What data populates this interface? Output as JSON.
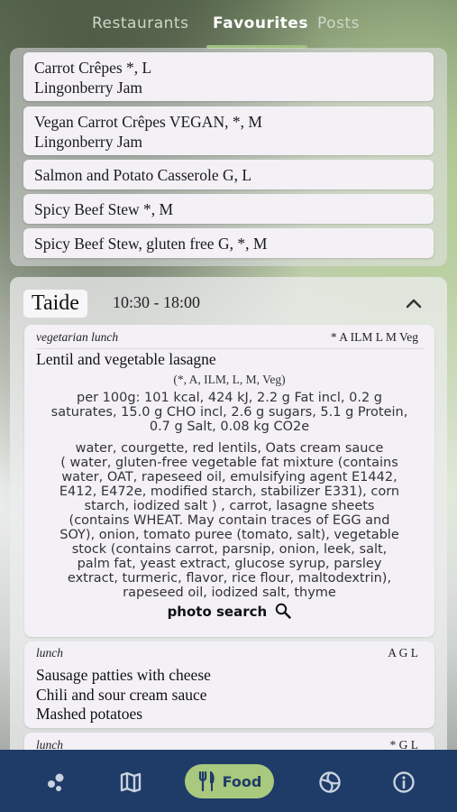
{
  "tabs": [
    {
      "label": "Restaurants",
      "active": false
    },
    {
      "label": "Favourites",
      "active": true
    },
    {
      "label": "Posts",
      "active": false
    }
  ],
  "favourites": [
    {
      "line1": "Carrot Crêpes *, L",
      "line2": "Lingonberry Jam"
    },
    {
      "line1": "Vegan Carrot Crêpes VEGAN, *, M",
      "line2": "Lingonberry Jam"
    },
    {
      "line1": "Salmon and Potato Casserole G, L"
    },
    {
      "line1": "Spicy Beef Stew *, M"
    },
    {
      "line1": "Spicy Beef Stew, gluten free G, *, M"
    }
  ],
  "restaurant": {
    "name": "Taide",
    "hours": "10:30 - 18:00",
    "menus": [
      {
        "category": "vegetarian lunch",
        "codes": "* A ILM L M Veg",
        "dish": "Lentil and vegetable lasagne",
        "dish_codes": "(*, A, ILM, L, M, Veg)",
        "nutrition_lines": [
          "per 100g: 101 kcal, 424 kJ, 2.2 g Fat incl, 0.2 g",
          "saturates, 15.0 g CHO incl, 2.6 g sugars, 5.1 g Protein,",
          "0.7 g Salt, 0.08 kg CO2e"
        ],
        "ingredient_lines": [
          "water, courgette, red lentils, Oats cream sauce",
          "( water, gluten-free vegetable fat mixture (contains",
          "water, OAT, rapeseed oil, emulsifying agent E1442,",
          "E412, E472e, modified starch, stabilizer E331), corn",
          "starch, iodized salt ) , carrot, lasagne sheets",
          "(contains WHEAT. May contain traces of EGG and",
          "SOY), onion, tomato puree (tomato, salt), vegetable",
          "stock (contains carrot, parsnip, onion, leek, salt,",
          "palm fat, yeast extract, glucose syrup, parsley",
          "extract, turmeric, flavor, rice flour, maltodextrin),",
          "rapeseed oil, iodized salt, thyme"
        ],
        "photo_search": "photo search"
      },
      {
        "category": "lunch",
        "codes": "A G L",
        "dishes": [
          "Sausage patties with cheese",
          "Chili and sour cream sauce",
          "Mashed potatoes"
        ]
      },
      {
        "category": "lunch",
        "codes": "* G L"
      }
    ]
  },
  "bottom_nav": {
    "items": [
      "dots-icon",
      "map-icon",
      "food-icon",
      "ball-icon",
      "info-icon"
    ],
    "food_label": "Food",
    "background": "#1f3b67",
    "active_pill": "#a8c97e"
  }
}
